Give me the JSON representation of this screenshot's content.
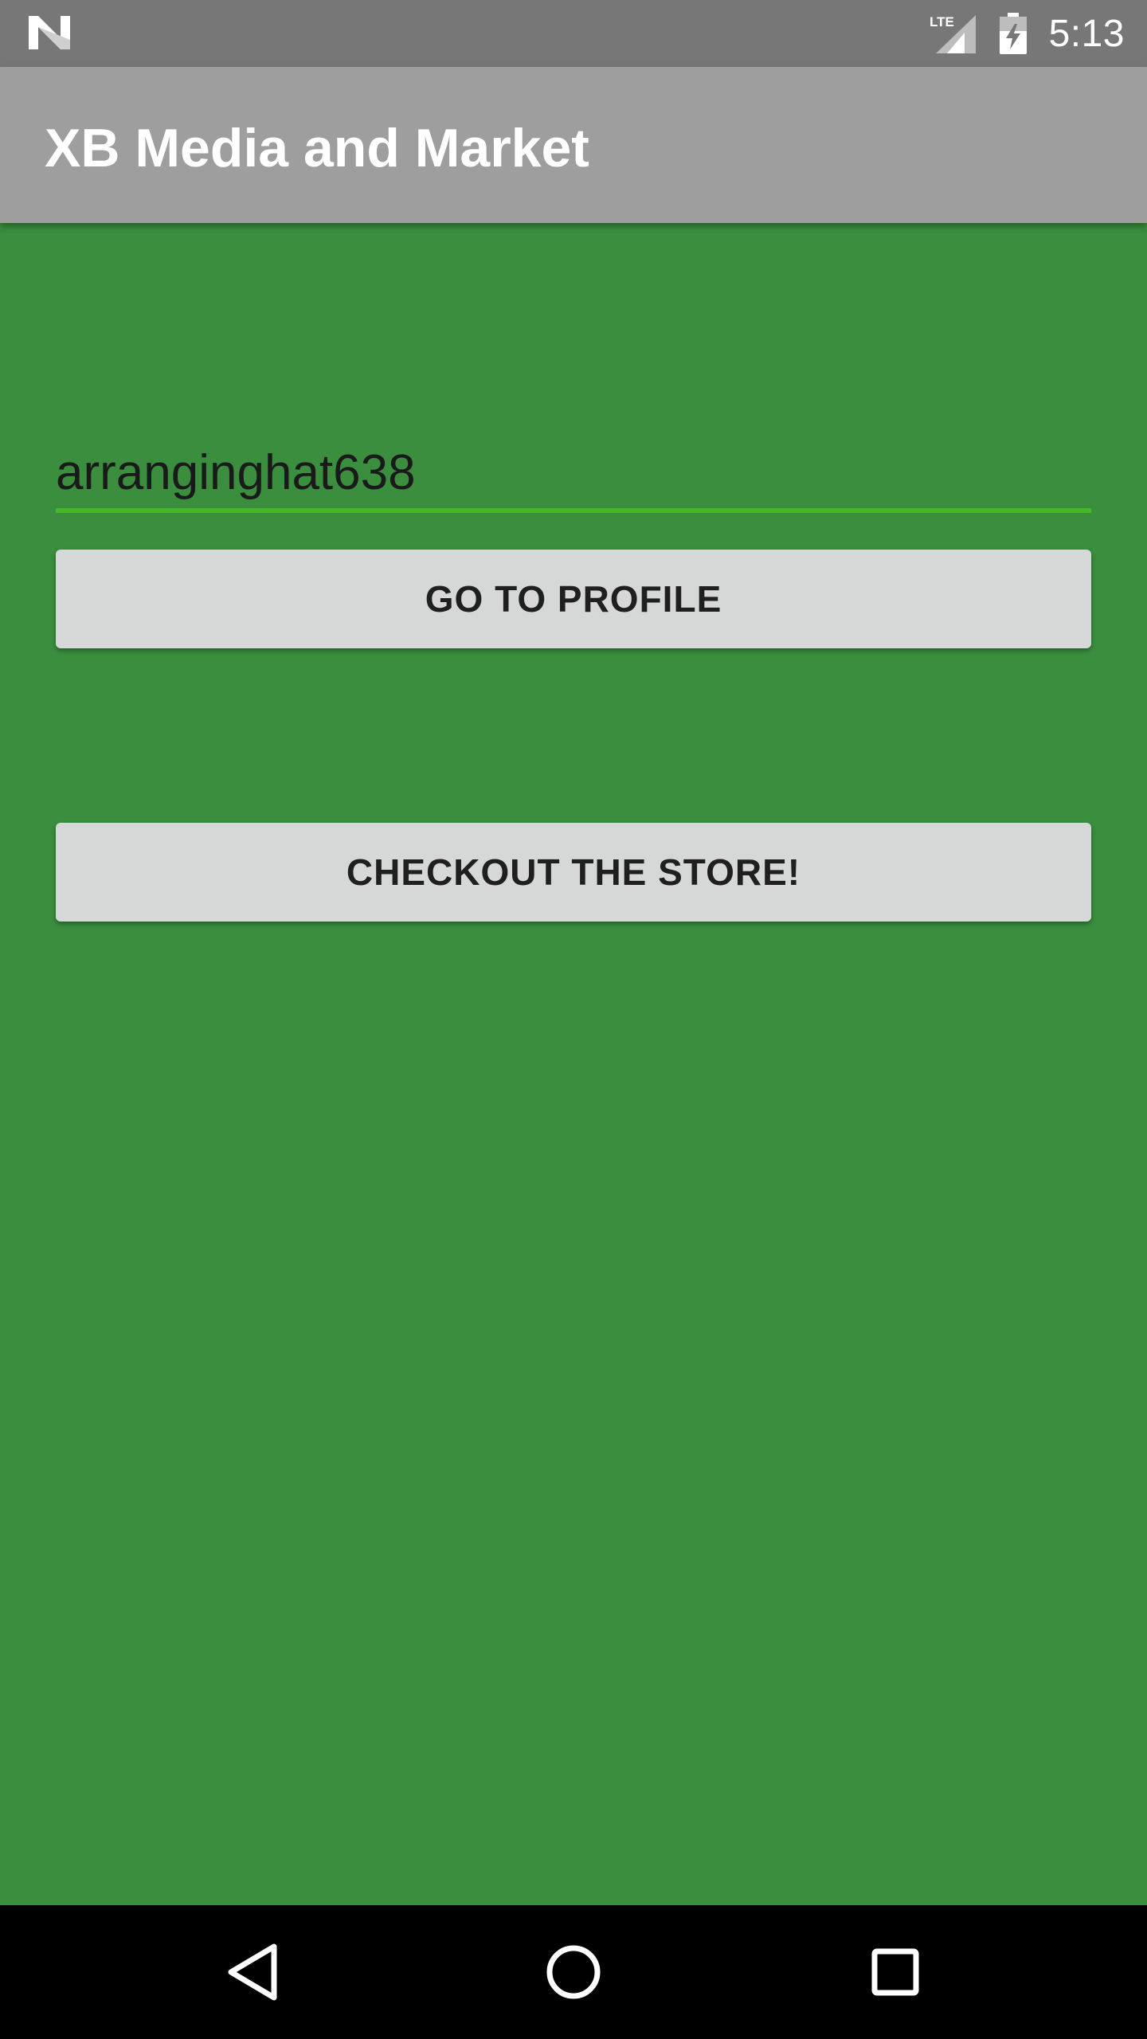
{
  "status_bar": {
    "time": "5:13",
    "network_label": "LTE",
    "icons": [
      "notification-n-icon",
      "lte-signal-icon",
      "battery-charging-icon"
    ]
  },
  "app_bar": {
    "title": "XB Media and Market",
    "background": "#9e9e9e"
  },
  "main": {
    "background": "#3a8e3e",
    "username_input": {
      "value": "arranginghat638",
      "underline_color": "#45b82a"
    },
    "go_to_profile_label": "GO TO PROFILE",
    "checkout_store_label": "CHECKOUT THE STORE!"
  },
  "nav_bar": {
    "icons": [
      "back-icon",
      "home-icon",
      "recents-icon"
    ]
  }
}
